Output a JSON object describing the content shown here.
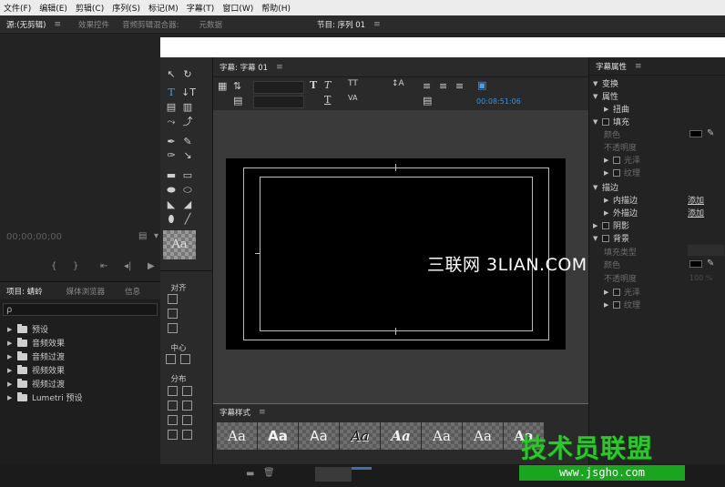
{
  "menubar": [
    "文件(F)",
    "编辑(E)",
    "剪辑(C)",
    "序列(S)",
    "标记(M)",
    "字幕(T)",
    "窗口(W)",
    "帮助(H)"
  ],
  "source_panel": {
    "tabs": [
      "源:(无剪辑)",
      "效果控件",
      "音频剪辑混合器:",
      "元数据"
    ],
    "timecode": "00;00;00;00"
  },
  "program_panel": {
    "tab": "节目: 序列 01"
  },
  "project_panel": {
    "tabs": [
      "项目: 蜻蛉",
      "媒体浏览器",
      "信息"
    ],
    "search_glyph": "ρ",
    "bins": [
      "预设",
      "音频效果",
      "音频过渡",
      "视频效果",
      "视频过渡",
      "Lumetri 预设"
    ]
  },
  "title_tools": {
    "preview_text": "Aa",
    "align_label": "对齐",
    "center_label": "中心",
    "distribute_label": "分布"
  },
  "title_designer": {
    "tab": "字幕: 字幕 01",
    "timecode": "00:08:51:06"
  },
  "watermark": "三联网 3LIAN.COM",
  "title_styles": {
    "tab": "字幕样式",
    "cells": [
      "Aa",
      "Aa",
      "Aa",
      "Aa",
      "Aa",
      "Aa",
      "Aa",
      "Aa"
    ]
  },
  "properties": {
    "tab": "字幕属性",
    "rows": {
      "transform": "变换",
      "properties": "属性",
      "distort": "扭曲",
      "fill": "填充",
      "color": "颜色",
      "opacity": "不透明度",
      "sheen": "光泽",
      "texture": "纹理",
      "strokes": "描边",
      "inner_strokes": "内描边",
      "outer_strokes": "外描边",
      "add1": "添加",
      "add2": "添加",
      "shadow": "阴影",
      "background": "背景",
      "fill_type": "填充类型",
      "bg_color": "颜色",
      "bg_opacity": "不透明度",
      "bg_opacity_value": "100 %",
      "bg_sheen": "光泽",
      "bg_texture": "纹理"
    }
  },
  "branding": {
    "logo": "技术员联盟",
    "url": "www.jsgho.com"
  },
  "colors": {
    "accent_blue": "#3e8fd4",
    "logo_green": "#2fc52f"
  }
}
